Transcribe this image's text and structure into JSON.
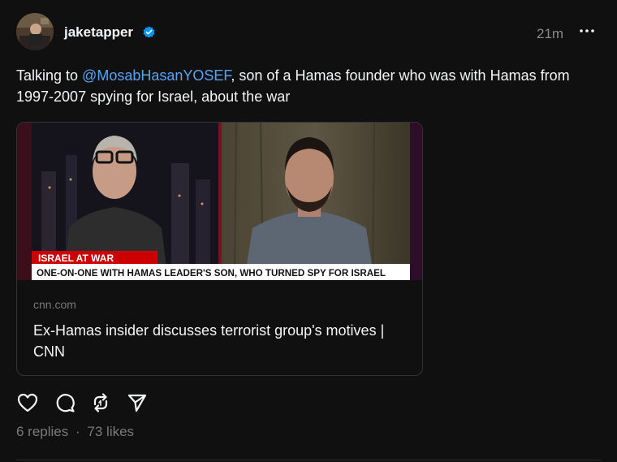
{
  "post": {
    "username": "jaketapper",
    "time": "21m",
    "text_before": "Talking to ",
    "mention": "@MosabHasanYOSEF",
    "text_after": ", son of a Hamas founder who was with Hamas from 1997-2007 spying for Israel, about the war"
  },
  "link_card": {
    "banner_top": "ISRAEL AT WAR",
    "banner_bottom": "ONE-ON-ONE WITH HAMAS LEADER'S SON, WHO TURNED SPY FOR ISRAEL",
    "domain": "cnn.com",
    "title": "Ex-Hamas insider discusses terrorist group's motives | CNN"
  },
  "stats": {
    "replies": "6 replies",
    "separator": "·",
    "likes": "73 likes"
  },
  "icons": [
    "verified-icon",
    "more-icon",
    "heart-icon",
    "comment-icon",
    "repost-icon",
    "share-icon"
  ],
  "colors": {
    "background": "#101010",
    "mention": "#5aa3f0",
    "verified": "#0095f6",
    "cnn_red": "#cc0000"
  }
}
